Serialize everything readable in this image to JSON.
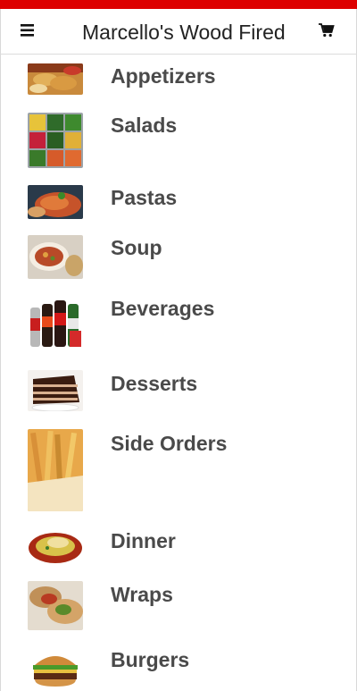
{
  "header": {
    "title": "Marcello's Wood Fired Pizza",
    "menu_icon": "hamburger-menu-icon",
    "cart_icon": "shopping-cart-icon",
    "accent_color": "#dd0000"
  },
  "categories": [
    {
      "label": "Appetizers",
      "image": "appetizers-photo"
    },
    {
      "label": "Salads",
      "image": "salads-photo"
    },
    {
      "label": "Pastas",
      "image": "pastas-photo"
    },
    {
      "label": "Soup",
      "image": "soup-photo"
    },
    {
      "label": "Beverages",
      "image": "beverages-photo"
    },
    {
      "label": "Desserts",
      "image": "desserts-photo"
    },
    {
      "label": "Side Orders",
      "image": "side-orders-photo"
    },
    {
      "label": "Dinner",
      "image": "dinner-photo"
    },
    {
      "label": "Wraps",
      "image": "wraps-photo"
    },
    {
      "label": "Burgers",
      "image": "burgers-photo"
    }
  ]
}
